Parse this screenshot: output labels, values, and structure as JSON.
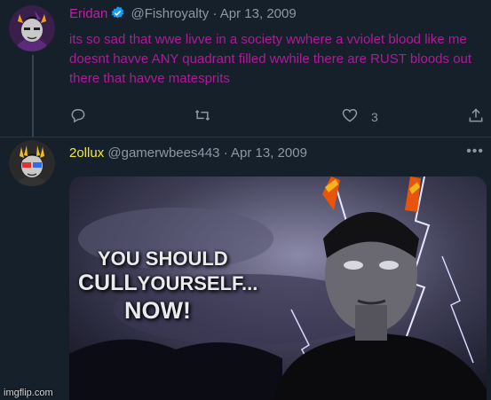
{
  "tweet1": {
    "display_name": "Eridan",
    "handle": "@Fishroyalty",
    "separator": "·",
    "date": "Apr 13, 2009",
    "text": "its so sad that wwe livve in a society wwhere a vviolet blood like me doesnt havve ANY quadrant filled wwhile there are RUST bloods out there that havve matesprits",
    "like_count": "3",
    "icons": [
      "reply-icon",
      "retweet-icon",
      "like-icon",
      "share-icon"
    ]
  },
  "tweet2": {
    "display_name": "2ollux",
    "handle": "@gamerwbees443",
    "separator": "·",
    "date": "Apr 13, 2009",
    "more": "•••"
  },
  "meme": {
    "line1": "YOU SHOULD",
    "line2a": "CULL",
    "line2b": "YOURSELF...",
    "line3": "NOW!"
  },
  "watermark": "imgflip.com",
  "colors": {
    "background": "#15202b",
    "eridan_name": "#c41ea6",
    "sollux_name": "#f4e542",
    "handle": "#8b98a5",
    "verified": "#1d9bf0"
  }
}
